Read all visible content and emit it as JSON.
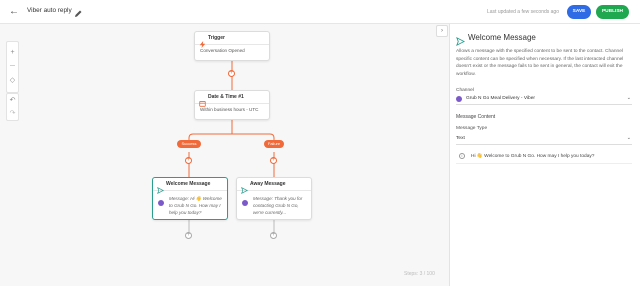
{
  "header": {
    "back_icon": "arrow-left-icon",
    "title": "Viber auto reply",
    "edit_icon": "pencil-icon",
    "last_updated": "Last updated a few seconds ago",
    "save_label": "SAVE",
    "publish_label": "PUBLISH"
  },
  "canvas": {
    "zoom_in": "+",
    "zoom_out": "—",
    "fit": "◇",
    "undo": "↶",
    "redo": "↷",
    "steps_label": "Steps: 3 / 100",
    "trigger": {
      "title": "Trigger",
      "body": "Conversation Opened"
    },
    "datetime": {
      "title": "Date & Time #1",
      "body": "Within business hours - UTC"
    },
    "branches": {
      "success": "Success",
      "failure": "Failure"
    },
    "welcome": {
      "title": "Welcome Message",
      "body": "Message: Hi 👋 Welcome to Grub N Go. How may I help you today?"
    },
    "away": {
      "title": "Away Message",
      "body": "Message: Thank you for contacting Grub N Go, we're currently..."
    },
    "node_tools": {
      "copy": "❐",
      "delete": "🗑"
    }
  },
  "panel": {
    "collapse": "›",
    "title": "Welcome Message",
    "description": "Allows a message with the specified content to be sent to the contact. Channel specific content can be specified when necessary. If the last interacted channel doesn't exist or the message fails to be sent in general, the contact will exit the workflow.",
    "channel_label": "Channel",
    "channel_value": "Grub N Go Meal Delivery - Viber",
    "content_label": "Message Content",
    "type_label": "Message Type",
    "type_value": "Text",
    "message_text": "Hi 👋 Welcome to Grub N Go. How may I help you today?",
    "chevron": "⌄"
  },
  "colors": {
    "accent_orange": "#f06a3a",
    "save_blue": "#2f6be5",
    "publish_green": "#1fa84f",
    "viber_purple": "#7b59c9",
    "selected_teal": "#2a9d8f"
  }
}
